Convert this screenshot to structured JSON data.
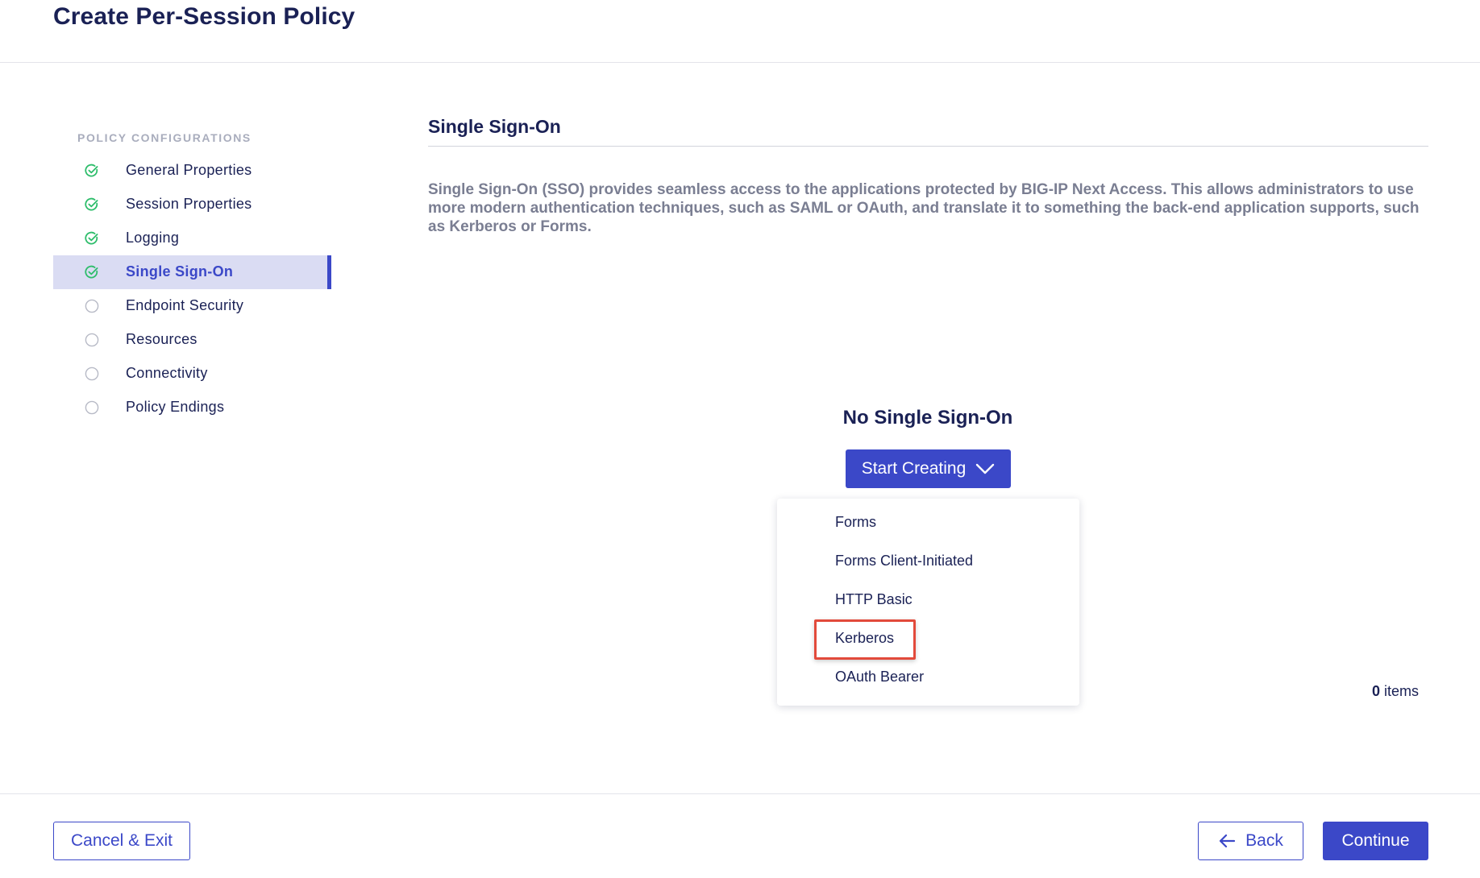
{
  "header": {
    "title": "Create Per-Session Policy"
  },
  "sidebar": {
    "heading": "POLICY CONFIGURATIONS",
    "items": [
      {
        "label": "General Properties",
        "status": "complete",
        "icon": "check-circle-icon"
      },
      {
        "label": "Session Properties",
        "status": "complete",
        "icon": "check-circle-icon"
      },
      {
        "label": "Logging",
        "status": "complete",
        "icon": "check-circle-icon"
      },
      {
        "label": "Single Sign-On",
        "status": "complete",
        "icon": "check-circle-icon",
        "active": true
      },
      {
        "label": "Endpoint Security",
        "status": "pending",
        "icon": "empty-circle-icon"
      },
      {
        "label": "Resources",
        "status": "pending",
        "icon": "empty-circle-icon"
      },
      {
        "label": "Connectivity",
        "status": "pending",
        "icon": "empty-circle-icon"
      },
      {
        "label": "Policy Endings",
        "status": "pending",
        "icon": "empty-circle-icon"
      }
    ]
  },
  "main": {
    "section_title": "Single Sign-On",
    "description": "Single Sign-On (SSO) provides seamless access to the applications protected by BIG-IP Next Access. This allows administrators to use more modern authentication techniques, such as SAML or OAuth, and translate it to something the back-end application supports, such as Kerberos or Forms.",
    "empty_title": "No Single Sign-On",
    "start_button_label": "Start Creating",
    "dropdown": {
      "items": [
        "Forms",
        "Forms Client-Initiated",
        "HTTP Basic",
        "Kerberos",
        "OAuth Bearer"
      ],
      "highlighted": "Kerberos"
    },
    "items_count": "0",
    "items_label": "items"
  },
  "footer": {
    "cancel_label": "Cancel & Exit",
    "back_label": "Back",
    "continue_label": "Continue"
  },
  "colors": {
    "primary": "#3b48c8",
    "heading": "#1a2155",
    "success": "#2ebd6b",
    "active_bg": "#dadcf3",
    "highlight": "#e24a3b"
  }
}
